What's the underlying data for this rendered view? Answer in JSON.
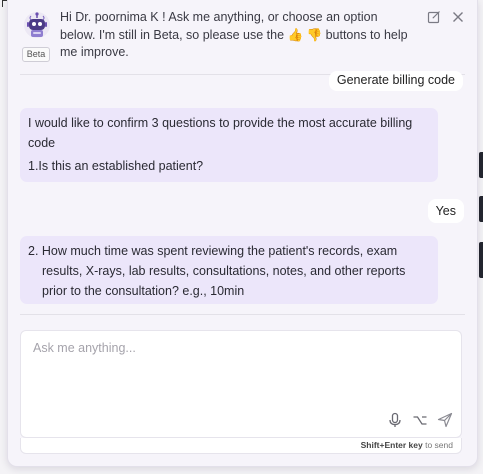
{
  "header": {
    "greeting": "Hi Dr. poornima K ! Ask me anything, or choose an option below. I'm still in Beta, so please use the 👍 👎 buttons to help me improve.",
    "beta_label": "Beta"
  },
  "messages": {
    "generate_billing": "Generate billing code",
    "confirm_intro": "I would like to confirm 3 questions to provide the most accurate billing code",
    "question_1": "1.Is this an established patient?",
    "yes_reply": "Yes",
    "question_2": "2. How much time was spent reviewing the patient's records, exam results, X-rays, lab results, consultations, notes, and other reports prior to the consultation? e.g., 10min"
  },
  "composer": {
    "placeholder": "Ask me anything...",
    "hint_key": "Shift+Enter key",
    "hint_text": "to send"
  },
  "colors": {
    "bot_bubble": "#ece6fa",
    "panel_bg": "#f6f4fa"
  }
}
